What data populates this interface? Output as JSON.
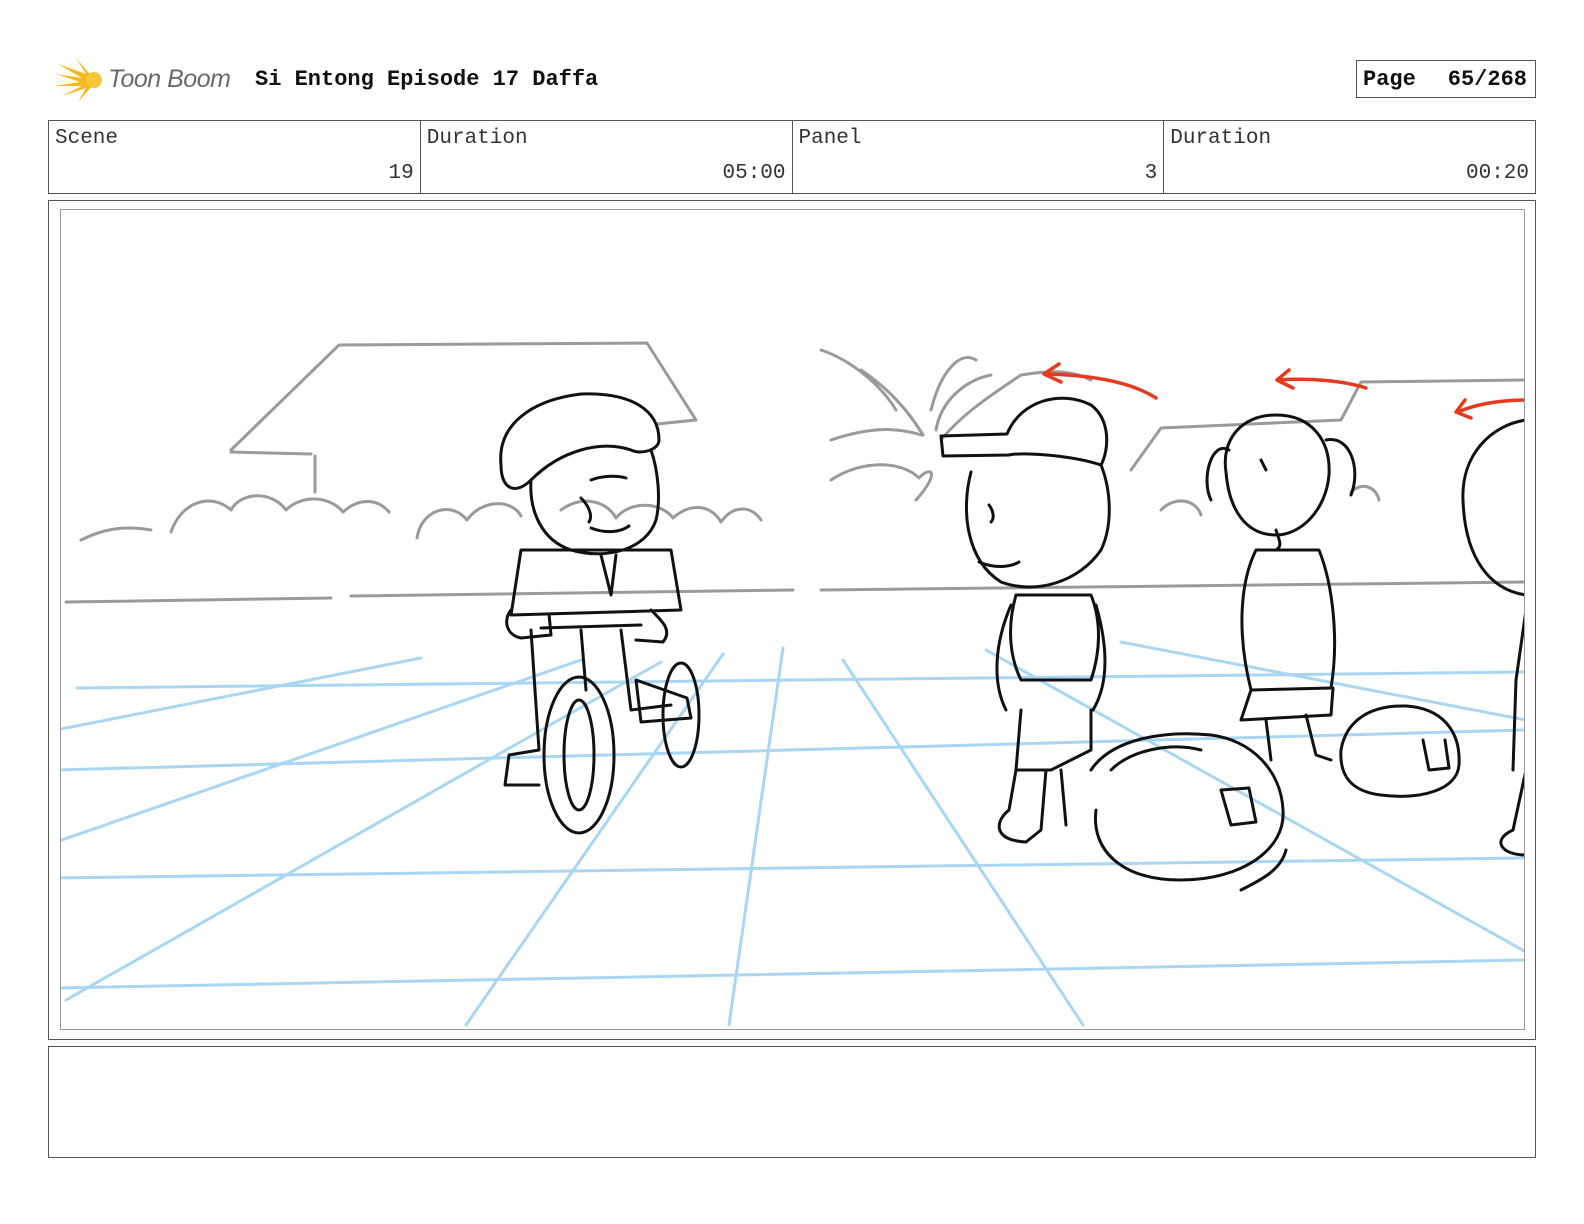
{
  "header": {
    "logo_text": "Toon Boom",
    "project_title": "Si Entong Episode 17 Daffa",
    "page_label": "Page",
    "page_number": "65/268"
  },
  "info": {
    "scene_label": "Scene",
    "scene_value": "19",
    "scene_duration_label": "Duration",
    "scene_duration_value": "05:00",
    "panel_label": "Panel",
    "panel_value": "3",
    "panel_duration_label": "Duration",
    "panel_duration_value": "00:20"
  },
  "colors": {
    "logo_star": "#f5b820",
    "perspective_grid": "#a9d6f2",
    "background_sketch": "#9a9a9a",
    "character_lines": "#111111",
    "motion_arrows": "#e63a1e"
  },
  "notes": {
    "text": ""
  }
}
